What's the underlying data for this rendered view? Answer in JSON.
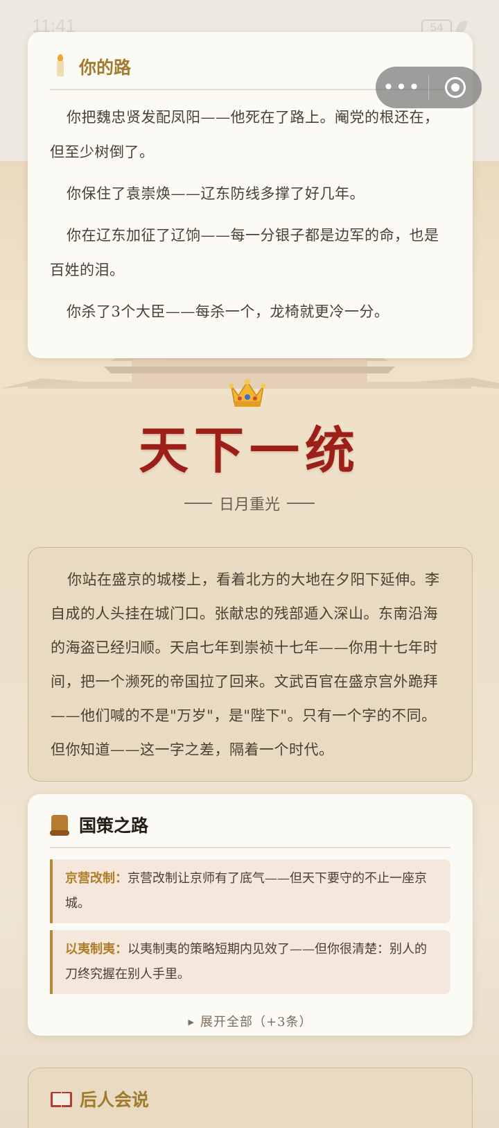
{
  "status_bar": {
    "time": "11:41",
    "battery": "54"
  },
  "path_card": {
    "title": "你的路",
    "paragraphs": [
      "你把魏忠贤发配凤阳——他死在了路上。阉党的根还在，但至少树倒了。",
      "你保住了袁崇焕——辽东防线多撑了好几年。",
      "你在辽东加征了辽饷——每一分银子都是边军的命，也是百姓的泪。",
      "你杀了3个大臣——每杀一个，龙椅就更冷一分。"
    ]
  },
  "capsule": {
    "more_icon": "more-dots-icon",
    "close_icon": "target-circle-icon"
  },
  "ending": {
    "title": "天下一统",
    "subtitle": "日月重光"
  },
  "narrative": "你站在盛京的城楼上，看着北方的大地在夕阳下延伸。李自成的人头挂在城门口。张献忠的残部遁入深山。东南沿海的海盗已经归顺。天启七年到崇祯十七年——你用十七年时间，把一个濒死的帝国拉了回来。文武百官在盛京宫外跪拜——他们喊的不是\"万岁\"，是\"陛下\"。只有一个字的不同。但你知道——这一字之差，隔着一个时代。",
  "policy": {
    "title": "国策之路",
    "items": [
      {
        "tag": "京营改制：",
        "text": "京营改制让京师有了底气——但天下要守的不止一座京城。"
      },
      {
        "tag": "以夷制夷：",
        "text": "以夷制夷的策略短期内见效了——但你很清楚：别人的刀终究握在别人手里。"
      }
    ],
    "expand_label": "展开全部（+3条）"
  },
  "later": {
    "title": "后人会说"
  },
  "colors": {
    "title_red": "#9c1f18",
    "gold": "#a07a2e",
    "card_bg": "#fcfaf5"
  }
}
